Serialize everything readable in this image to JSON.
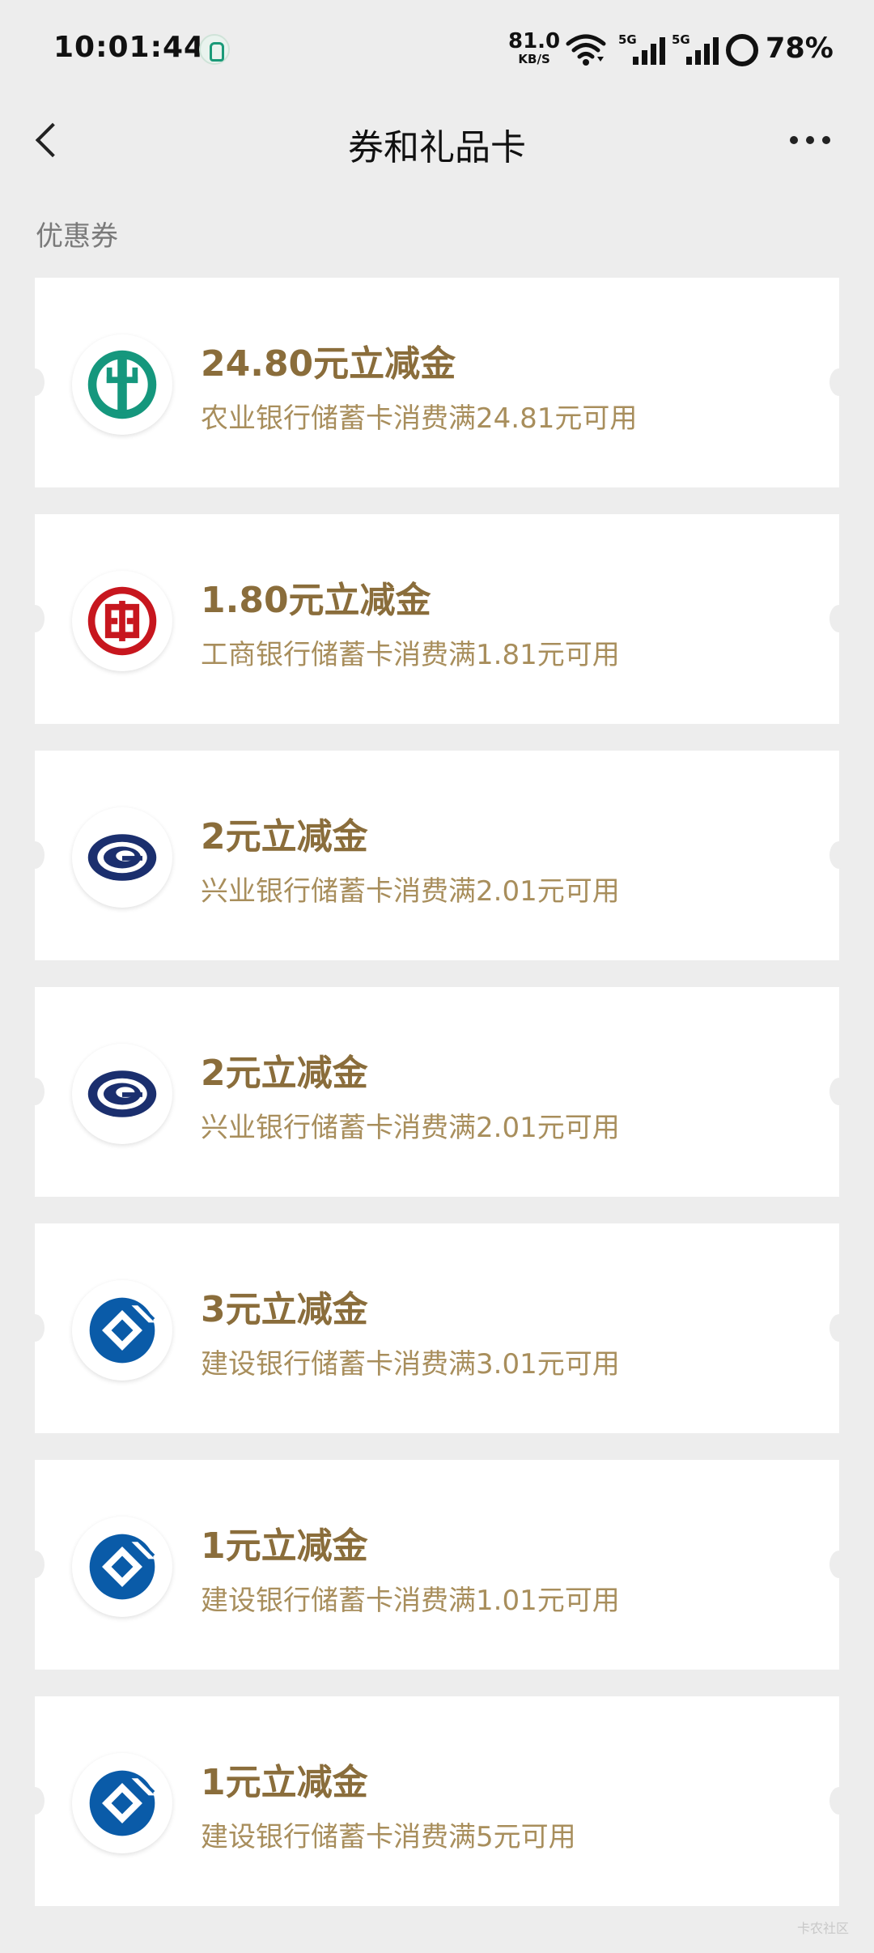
{
  "status_bar": {
    "time": "10:01:44",
    "net_speed_value": "81.0",
    "net_speed_unit": "KB/S",
    "signal1_label": "5G",
    "signal2_label": "5G",
    "battery": "78%"
  },
  "nav": {
    "title": "券和礼品卡"
  },
  "section": {
    "label": "优惠券"
  },
  "coupons": [
    {
      "amount": "24.80元立减金",
      "desc": "农业银行储蓄卡消费满24.81元可用",
      "bank_icon": "abc-bank-icon"
    },
    {
      "amount": "1.80元立减金",
      "desc": "工商银行储蓄卡消费满1.81元可用",
      "bank_icon": "icbc-bank-icon"
    },
    {
      "amount": "2元立减金",
      "desc": "兴业银行储蓄卡消费满2.01元可用",
      "bank_icon": "cib-bank-icon"
    },
    {
      "amount": "2元立减金",
      "desc": "兴业银行储蓄卡消费满2.01元可用",
      "bank_icon": "cib-bank-icon"
    },
    {
      "amount": "3元立减金",
      "desc": "建设银行储蓄卡消费满3.01元可用",
      "bank_icon": "ccb-bank-icon"
    },
    {
      "amount": "1元立减金",
      "desc": "建设银行储蓄卡消费满1.01元可用",
      "bank_icon": "ccb-bank-icon"
    },
    {
      "amount": "1元立减金",
      "desc": "建设银行储蓄卡消费满5元可用",
      "bank_icon": "ccb-bank-icon"
    }
  ],
  "watermark": "卡农社区",
  "colors": {
    "background": "#ededed",
    "coupon_amount": "#8a6d3b",
    "coupon_desc": "#a88e5c",
    "abc_green": "#15977d",
    "icbc_red": "#c7161e",
    "cib_navy": "#1b2f6e",
    "ccb_blue": "#0a5ba8"
  }
}
